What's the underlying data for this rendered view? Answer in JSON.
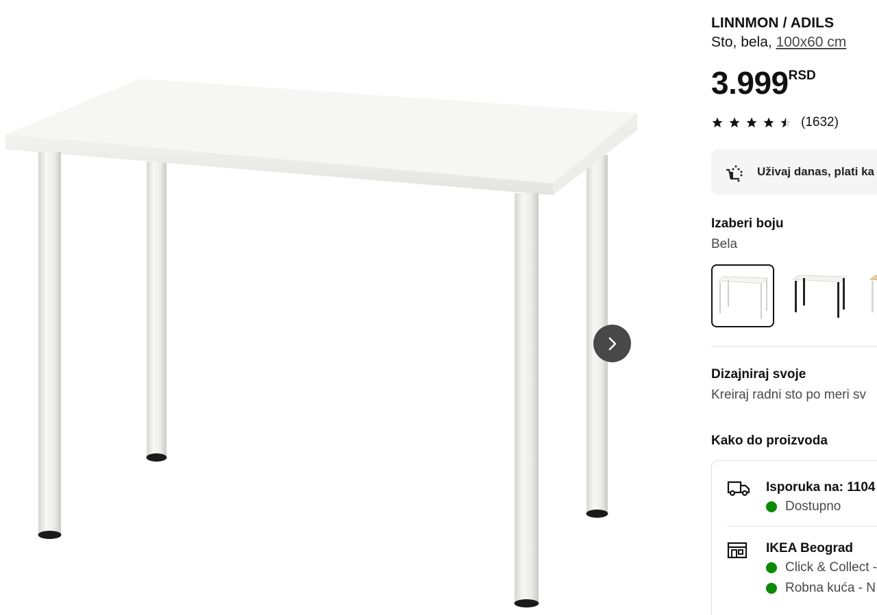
{
  "gallery": {
    "next_icon": "chevron-right-icon"
  },
  "product": {
    "name": "LINNMON / ADILS",
    "description_prefix": "Sto, bela, ",
    "size_link": "100x60 cm",
    "price_amount": "3.999",
    "price_currency": "RSD",
    "rating_value": 4.5,
    "rating_max": 5,
    "review_count": "(1632)"
  },
  "promo": {
    "icon": "cart-payment-icon",
    "text": "Uživaj danas, plati ka"
  },
  "color_picker": {
    "heading": "Izaberi boju",
    "selected_label": "Bela",
    "options": [
      "white-table",
      "black-legs-table",
      "birch-table"
    ]
  },
  "design": {
    "heading": "Dizajniraj svoje",
    "text": "Kreiraj radni sto po meri sv"
  },
  "availability": {
    "heading": "Kako do proizvoda",
    "delivery": {
      "icon": "truck-icon",
      "title": "Isporuka na: 1104",
      "status": "Dostupno"
    },
    "store": {
      "icon": "store-icon",
      "title": "IKEA Beograd",
      "status_1": "Click & Collect -",
      "status_2": "Robna kuća - N"
    }
  },
  "colors": {
    "available": "#0a8a00",
    "next_button": "#484848"
  }
}
